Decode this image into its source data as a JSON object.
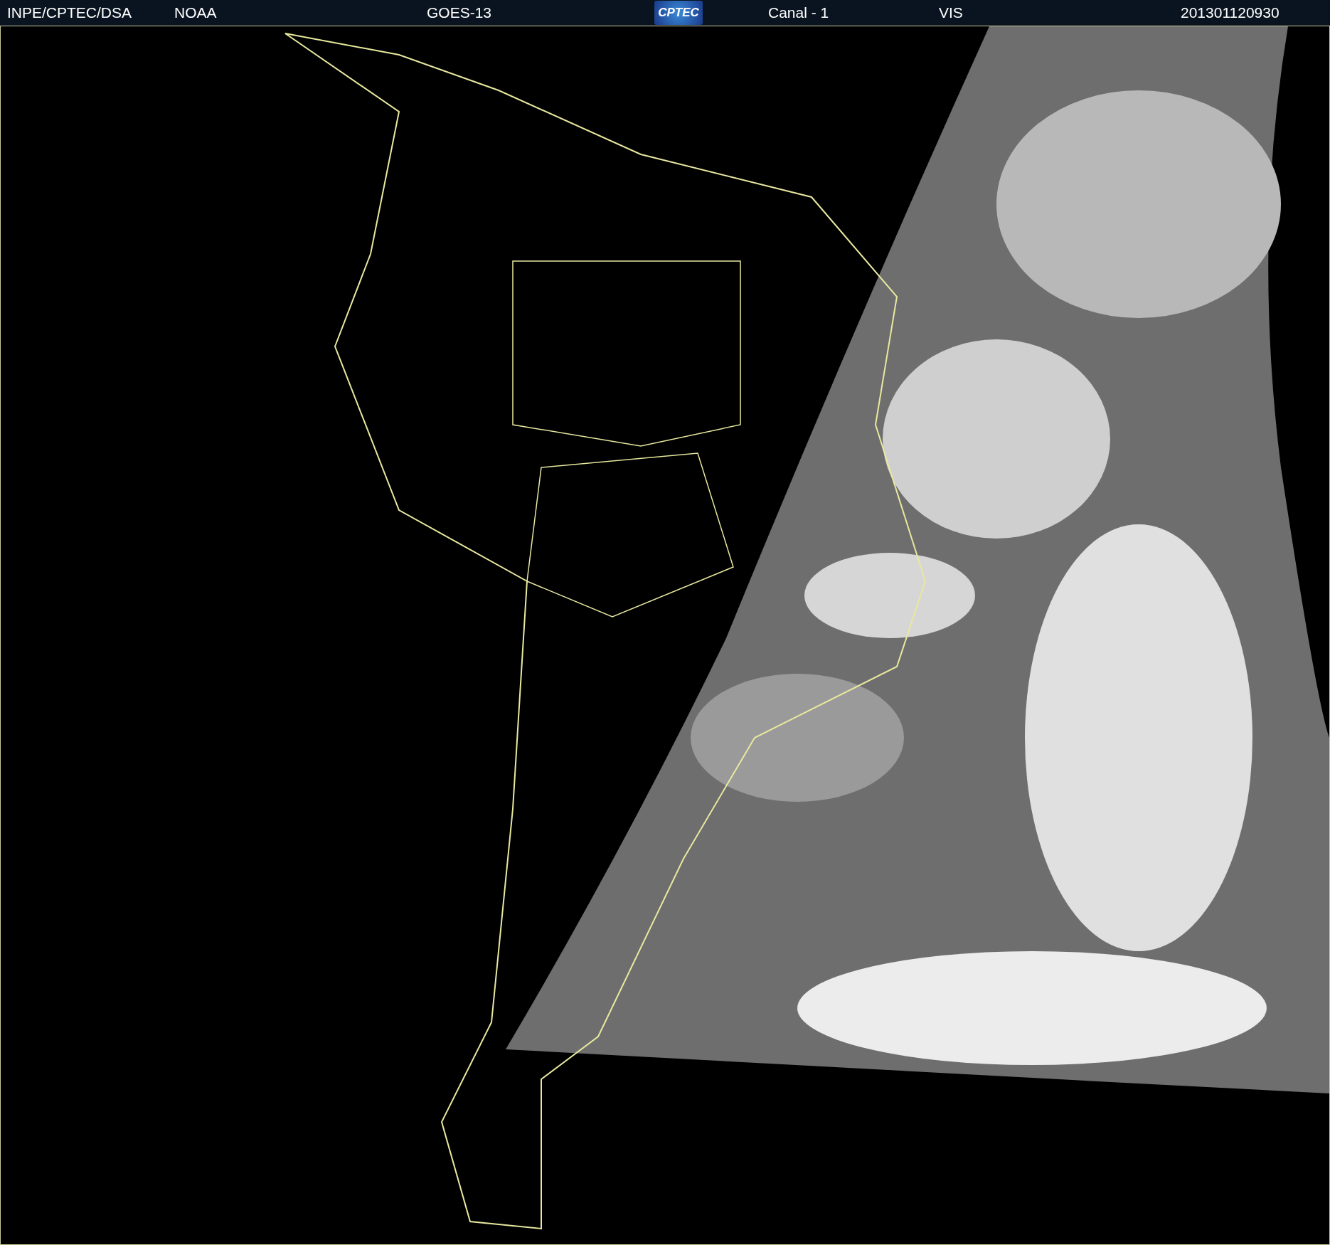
{
  "header": {
    "items": [
      {
        "kind": "text",
        "text": "INPE/CPTEC/DSA"
      },
      {
        "kind": "text",
        "text": "NOAA"
      },
      {
        "kind": "text",
        "text": "GOES-13"
      },
      {
        "kind": "logo",
        "text": "CPTEC"
      },
      {
        "kind": "text",
        "text": "Canal - 1"
      },
      {
        "kind": "text",
        "text": "VIS"
      },
      {
        "kind": "text",
        "text": "201301120930"
      }
    ]
  }
}
